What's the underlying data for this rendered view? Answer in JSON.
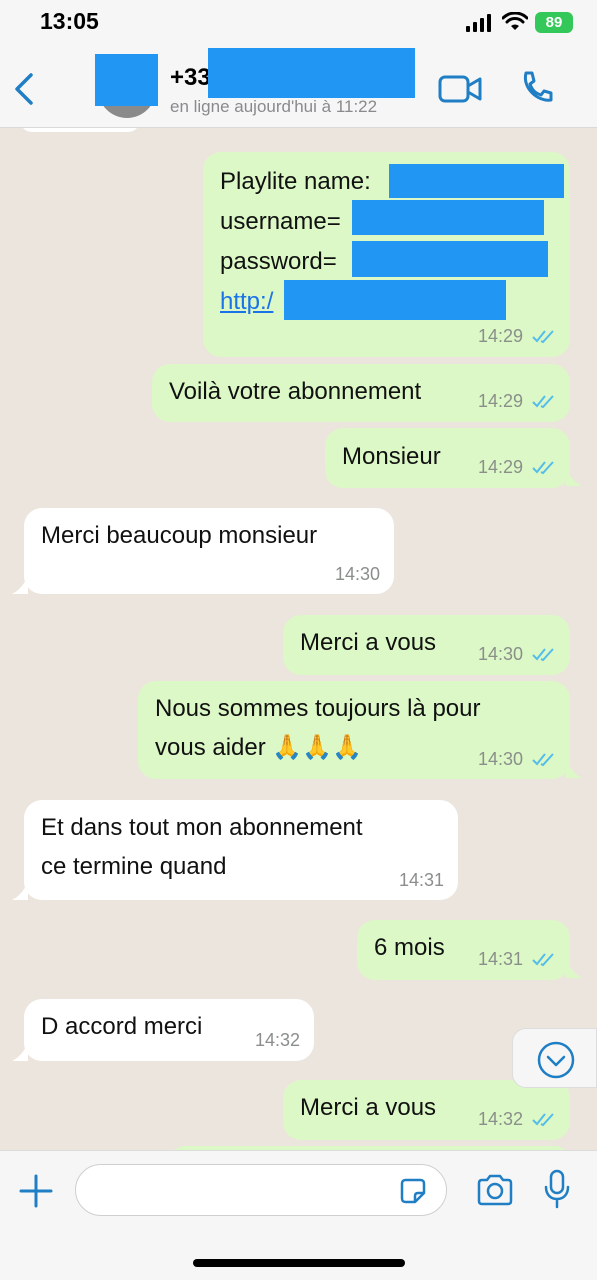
{
  "status_bar": {
    "time": "13:05",
    "battery": "89"
  },
  "header": {
    "contact_name": "+33",
    "contact_status": "en ligne aujourd'hui à 11:22"
  },
  "messages": [
    {
      "dir": "out",
      "lines": [
        "Playlite name:",
        "username=",
        "password=",
        "http:/"
      ],
      "time": "14:29",
      "status": "read"
    },
    {
      "dir": "out",
      "lines": [
        "Voilà votre abonnement"
      ],
      "time": "14:29",
      "status": "read"
    },
    {
      "dir": "out",
      "lines": [
        "Monsieur"
      ],
      "time": "14:29",
      "status": "read"
    },
    {
      "dir": "in",
      "lines": [
        "Merci beaucoup monsieur"
      ],
      "time": "14:30"
    },
    {
      "dir": "out",
      "lines": [
        "Merci a vous"
      ],
      "time": "14:30",
      "status": "read"
    },
    {
      "dir": "out",
      "lines": [
        "Nous sommes toujours là pour",
        "vous aider 🙏🙏🙏"
      ],
      "time": "14:30",
      "status": "read"
    },
    {
      "dir": "in",
      "lines": [
        "Et dans tout mon abonnement",
        "ce termine quand"
      ],
      "time": "14:31"
    },
    {
      "dir": "out",
      "lines": [
        "6 mois"
      ],
      "time": "14:31",
      "status": "read"
    },
    {
      "dir": "in",
      "lines": [
        "D accord merci"
      ],
      "time": "14:32"
    },
    {
      "dir": "out",
      "lines": [
        "Merci a vous"
      ],
      "time": "14:32",
      "status": "read"
    }
  ],
  "composer": {
    "placeholder": ""
  },
  "colors": {
    "accent": "#1f7ec4",
    "out_bubble": "#dcf8c6",
    "in_bubble": "#ffffff",
    "redaction": "#2196f3",
    "read_tick": "#53bdeb"
  }
}
